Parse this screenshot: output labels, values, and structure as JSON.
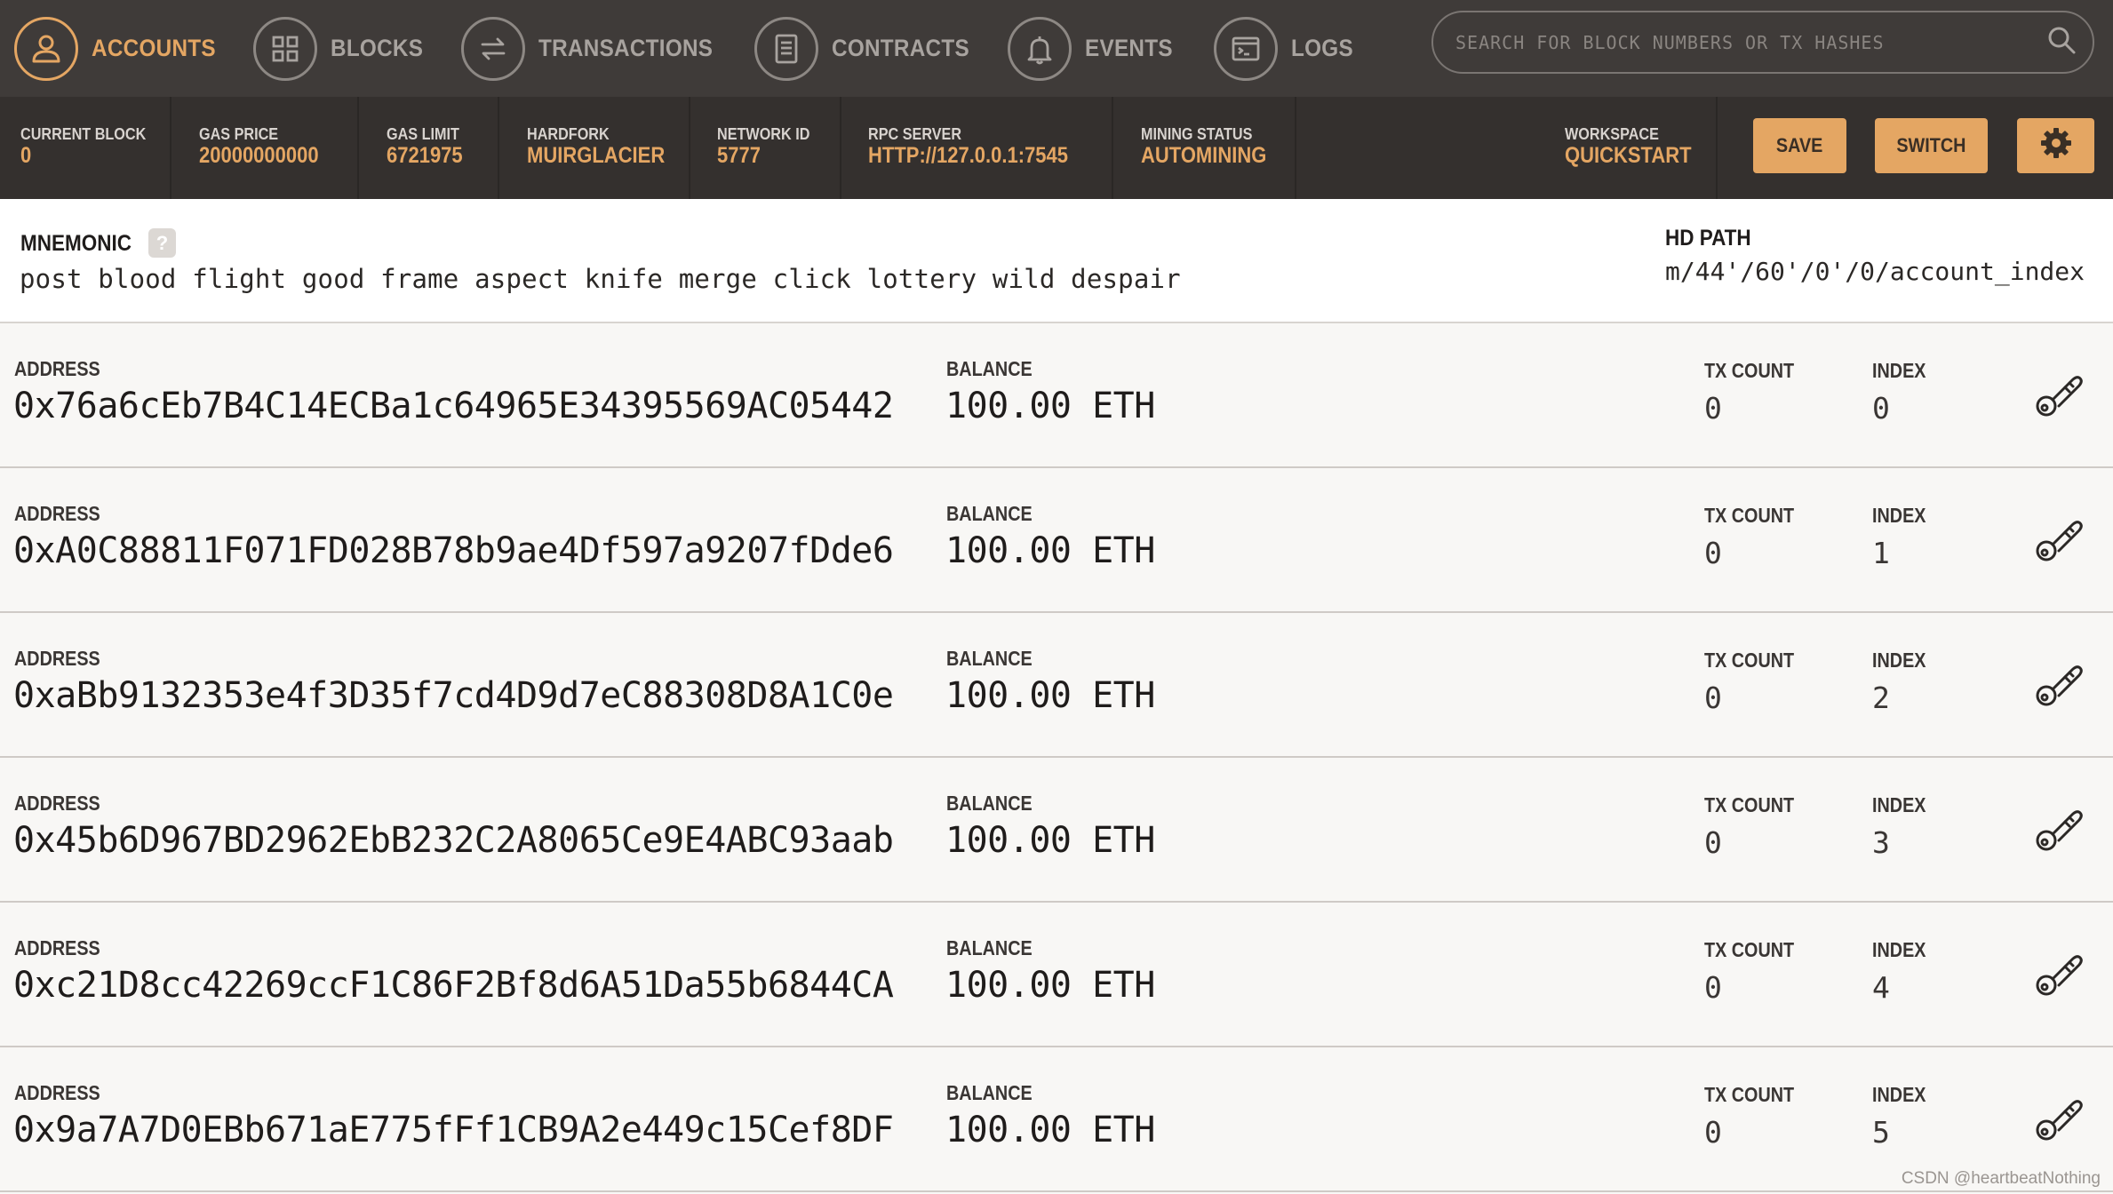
{
  "nav": {
    "items": [
      {
        "label": "ACCOUNTS",
        "icon": "person-icon",
        "active": true
      },
      {
        "label": "BLOCKS",
        "icon": "grid-icon",
        "active": false
      },
      {
        "label": "TRANSACTIONS",
        "icon": "arrows-swap-icon",
        "active": false
      },
      {
        "label": "CONTRACTS",
        "icon": "document-icon",
        "active": false
      },
      {
        "label": "EVENTS",
        "icon": "bell-icon",
        "active": false
      },
      {
        "label": "LOGS",
        "icon": "terminal-icon",
        "active": false
      }
    ],
    "search_placeholder": "SEARCH FOR BLOCK NUMBERS OR TX HASHES"
  },
  "stats": {
    "current_block": {
      "label": "CURRENT BLOCK",
      "value": "0"
    },
    "gas_price": {
      "label": "GAS PRICE",
      "value": "20000000000"
    },
    "gas_limit": {
      "label": "GAS LIMIT",
      "value": "6721975"
    },
    "hardfork": {
      "label": "HARDFORK",
      "value": "MUIRGLACIER"
    },
    "network_id": {
      "label": "NETWORK ID",
      "value": "5777"
    },
    "rpc_server": {
      "label": "RPC SERVER",
      "value": "HTTP://127.0.0.1:7545"
    },
    "mining_status": {
      "label": "MINING STATUS",
      "value": "AUTOMINING"
    },
    "workspace": {
      "label": "WORKSPACE",
      "value": "QUICKSTART"
    }
  },
  "actions": {
    "save": "SAVE",
    "switch": "SWITCH"
  },
  "mnemonic": {
    "label": "MNEMONIC",
    "help": "?",
    "words": "post blood flight good frame aspect knife merge click lottery wild despair",
    "hd_path_label": "HD PATH",
    "hd_path": "m/44'/60'/0'/0/account_index"
  },
  "labels": {
    "address": "ADDRESS",
    "balance": "BALANCE",
    "tx_count": "TX COUNT",
    "index": "INDEX"
  },
  "accounts": [
    {
      "address": "0x76a6cEb7B4C14ECBa1c64965E34395569AC05442",
      "balance": "100.00 ETH",
      "tx_count": "0",
      "index": "0"
    },
    {
      "address": "0xA0C88811F071FD028B78b9ae4Df597a9207fDde6",
      "balance": "100.00 ETH",
      "tx_count": "0",
      "index": "1"
    },
    {
      "address": "0xaBb9132353e4f3D35f7cd4D9d7eC88308D8A1C0e",
      "balance": "100.00 ETH",
      "tx_count": "0",
      "index": "2"
    },
    {
      "address": "0x45b6D967BD2962EbB232C2A8065Ce9E4ABC93aab",
      "balance": "100.00 ETH",
      "tx_count": "0",
      "index": "3"
    },
    {
      "address": "0xc21D8cc42269ccF1C86F2Bf8d6A51Da55b6844CA",
      "balance": "100.00 ETH",
      "tx_count": "0",
      "index": "4"
    },
    {
      "address": "0x9a7A7D0EBb671aE775fFf1CB9A2e449c15Cef8DF",
      "balance": "100.00 ETH",
      "tx_count": "0",
      "index": "5"
    }
  ],
  "watermark": "CSDN @heartbeatNothing",
  "colors": {
    "accent": "#e4a663",
    "nav_bg": "#3f3b39",
    "stats_bg": "#34302e"
  }
}
